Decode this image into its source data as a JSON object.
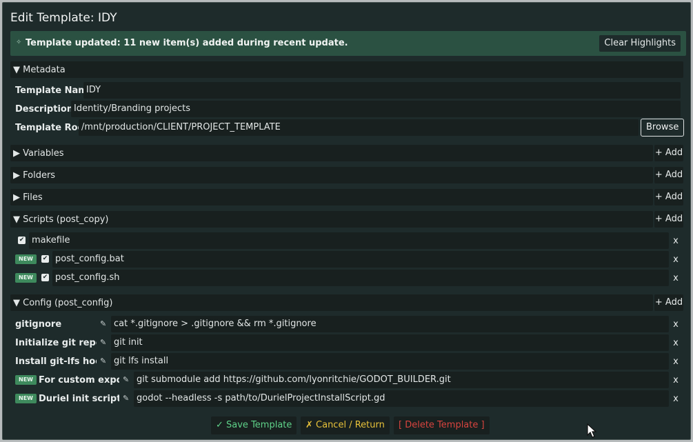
{
  "window": {
    "title": "Edit Template: IDY"
  },
  "banner": {
    "icon": "sparkle-icon",
    "text": "Template updated: 11 new item(s) added during recent update.",
    "clear_label": "Clear Highlights"
  },
  "metadata": {
    "header": "▼ Metadata",
    "name_label": "Template Name",
    "name_value": "IDY",
    "description_label": "Description",
    "description_value": "Identity/Branding projects",
    "root_label": "Template Root",
    "root_value": "/mnt/production/CLIENT/PROJECT_TEMPLATE",
    "browse_label": "Browse"
  },
  "sections": {
    "variables": "▶ Variables",
    "folders": "▶ Folders",
    "files": "▶ Files",
    "scripts": "▼ Scripts (post_copy)",
    "config": "▼ Config (post_config)"
  },
  "add_label": "+ Add",
  "remove_label": "x",
  "new_badge": "NEW",
  "check_mark": "✔",
  "pencil": "✎",
  "scripts": [
    {
      "name": "makefile",
      "checked": true,
      "new": false
    },
    {
      "name": "post_config.bat",
      "checked": true,
      "new": true
    },
    {
      "name": "post_config.sh",
      "checked": true,
      "new": true
    }
  ],
  "config": [
    {
      "label": "gitignore",
      "command": "cat *.gitignore > .gitignore && rm *.gitignore",
      "new": false
    },
    {
      "label": "Initialize git repository",
      "command": "git init",
      "new": false
    },
    {
      "label": "Install git-lfs hooks",
      "command": "git lfs install",
      "new": false
    },
    {
      "label": "For custom export t",
      "command": "git submodule add https://github.com/lyonritchie/GODOT_BUILDER.git",
      "new": true
    },
    {
      "label": "Duriel init script",
      "command": "godot --headless -s path/to/DurielProjectInstallScript.gd",
      "new": true
    }
  ],
  "footer": {
    "save_label": "✓ Save Template",
    "cancel_label": "✗ Cancel / Return",
    "delete_label": "[ Delete Template ]"
  },
  "colors": {
    "save": "#5fd38a",
    "cancel": "#e8c23a",
    "delete": "#d9443f"
  }
}
